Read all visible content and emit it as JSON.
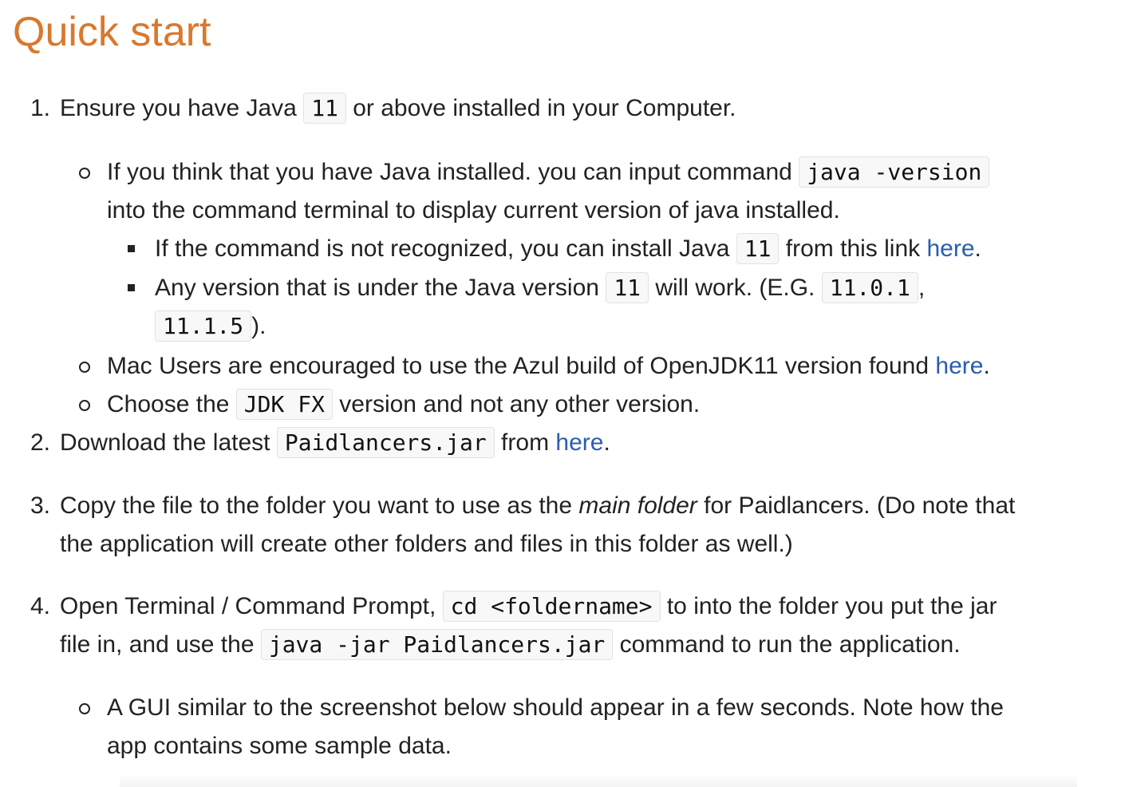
{
  "heading": "Quick start",
  "step1": {
    "number": "1.",
    "pre": "Ensure you have Java ",
    "code": "11",
    "post": " or above installed in your Computer.",
    "b1": {
      "pre": "If you think that you have Java installed. you can input command ",
      "code": "java -version",
      "line2": "into the command terminal to display current version of java installed.",
      "s1": {
        "pre": "If the command is not recognized, you can install Java ",
        "code": "11",
        "mid": " from this link ",
        "link": "here",
        "post": "."
      },
      "s2": {
        "pre": "Any version that is under the Java version ",
        "code1": "11",
        "mid": " will work. (E.G. ",
        "code2": "11.0.1",
        "comma": ",",
        "code3": "11.1.5",
        "post": ")."
      }
    },
    "b2": {
      "pre": "Mac Users are encouraged to use the Azul build of OpenJDK11 version found ",
      "link": "here",
      "post": "."
    },
    "b3": {
      "pre": "Choose the ",
      "code": "JDK FX",
      "post": " version and not any other version."
    }
  },
  "step2": {
    "number": "2.",
    "pre": "Download the latest ",
    "code": "Paidlancers.jar",
    "mid": " from ",
    "link": "here",
    "post": "."
  },
  "step3": {
    "number": "3.",
    "pre": "Copy the file to the folder you want to use as the ",
    "em": "main folder",
    "post": " for Paidlancers. (Do note that",
    "line2": "the application will create other folders and files in this folder as well.)"
  },
  "step4": {
    "number": "4.",
    "pre": "Open Terminal / Command Prompt, ",
    "code1": "cd <foldername>",
    "mid": " to into the folder you put the jar",
    "line2pre": "file in, and use the ",
    "code2": "java -jar Paidlancers.jar",
    "line2post": " command to run the application.",
    "b1": {
      "line1": "A GUI similar to the screenshot below should appear in a few seconds. Note how the",
      "line2": "app contains some sample data."
    }
  },
  "colors": {
    "heading": "#d9782d",
    "link": "#2a5db0",
    "text": "#222222"
  }
}
